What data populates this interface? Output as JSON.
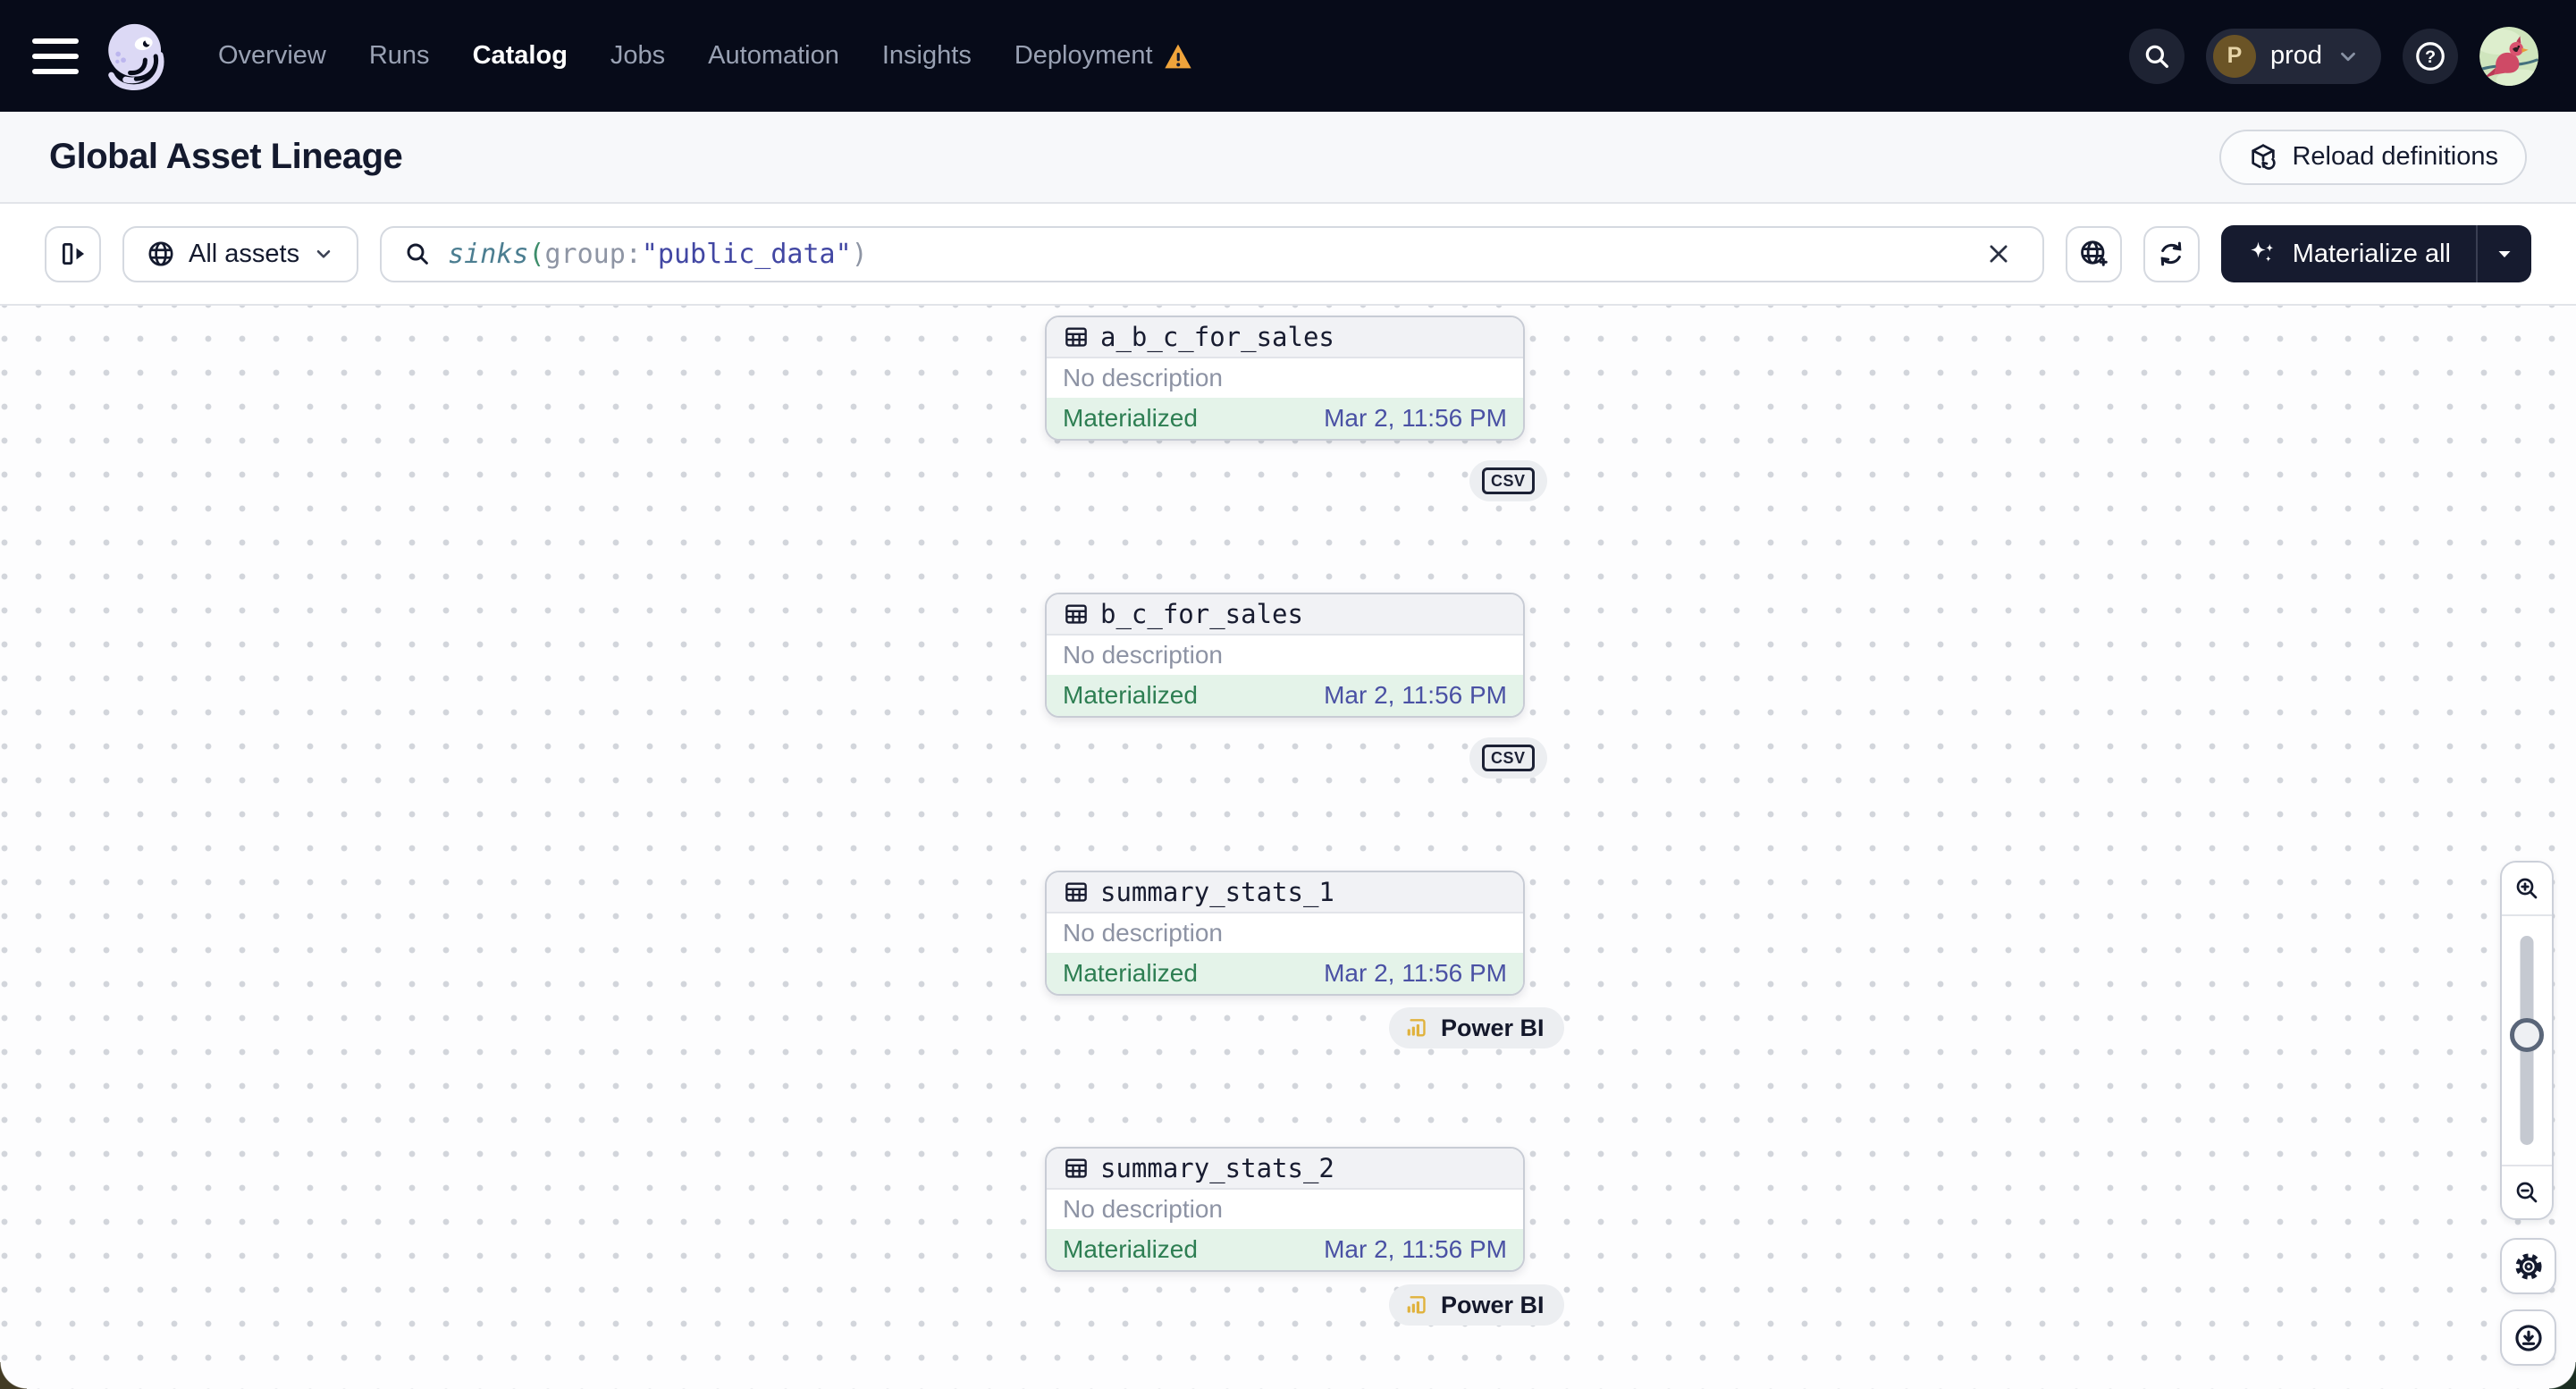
{
  "colors": {
    "nav_bg": "#070b19",
    "nav_text": "#99a1b3",
    "accent_warning": "#f0a43b",
    "header_bg": "#f7f8fa",
    "border": "#e2e4e9",
    "control_border": "#d5d9e0",
    "text_primary": "#141a2e",
    "text_muted": "#8d93a4",
    "dark_button_bg": "#161b2f",
    "green_text": "#2d7e52",
    "green_bg": "#e4f3e9",
    "timestamp_text": "#4a51a4",
    "card_border": "#c8ccd5",
    "card_header_bg": "#f1f2f5",
    "tag_bg": "#eceef1",
    "powerbi_gold": "#e0b23d",
    "code_fn": "#4c7e91",
    "code_paren": "#3e8d6b",
    "code_key": "#8e95a4",
    "code_value": "#4247a3",
    "dot_color": "#d2d5db",
    "graph_bg": "#fdfdfe"
  },
  "nav": {
    "items": [
      {
        "label": "Overview"
      },
      {
        "label": "Runs"
      },
      {
        "label": "Catalog",
        "active": true
      },
      {
        "label": "Jobs"
      },
      {
        "label": "Automation"
      },
      {
        "label": "Insights"
      },
      {
        "label": "Deployment",
        "warning": true
      }
    ],
    "environment": {
      "initial": "P",
      "name": "prod"
    }
  },
  "header": {
    "title": "Global Asset Lineage",
    "reload_button": "Reload definitions"
  },
  "toolbar": {
    "scope_button": "All assets",
    "search": {
      "fn": "sinks",
      "open": "(",
      "key": "group:",
      "value": "\"public_data\"",
      "close": ")"
    },
    "materialize_button": "Materialize all"
  },
  "graph": {
    "assets": [
      {
        "name": "a_b_c_for_sales",
        "description": "No description",
        "status": "Materialized",
        "timestamp": "Mar 2, 11:56 PM",
        "tag": "CSV"
      },
      {
        "name": "b_c_for_sales",
        "description": "No description",
        "status": "Materialized",
        "timestamp": "Mar 2, 11:56 PM",
        "tag": "CSV"
      },
      {
        "name": "summary_stats_1",
        "description": "No description",
        "status": "Materialized",
        "timestamp": "Mar 2, 11:56 PM",
        "tag": "Power BI"
      },
      {
        "name": "summary_stats_2",
        "description": "No description",
        "status": "Materialized",
        "timestamp": "Mar 2, 11:56 PM",
        "tag": "Power BI"
      }
    ]
  }
}
